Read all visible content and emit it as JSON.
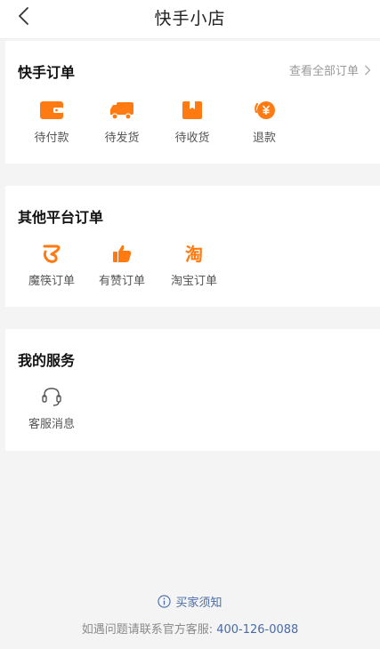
{
  "nav": {
    "title": "快手小店",
    "back_icon": "chevron-left-icon"
  },
  "kuaishou_orders": {
    "title": "快手订单",
    "see_all": "查看全部订单",
    "items": [
      {
        "label": "待付款",
        "icon": "wallet-icon"
      },
      {
        "label": "待发货",
        "icon": "truck-icon"
      },
      {
        "label": "待收货",
        "icon": "package-icon"
      },
      {
        "label": "退款",
        "icon": "refund-yen-icon"
      }
    ]
  },
  "other_platforms": {
    "title": "其他平台订单",
    "items": [
      {
        "label": "魔筷订单",
        "icon": "mokuai-logo-icon"
      },
      {
        "label": "有赞订单",
        "icon": "thumbs-up-icon"
      },
      {
        "label": "淘宝订单",
        "icon": "taobao-icon",
        "glyph": "淘"
      }
    ]
  },
  "my_services": {
    "title": "我的服务",
    "items": [
      {
        "label": "客服消息",
        "icon": "headset-icon"
      }
    ]
  },
  "footer": {
    "notice": "买家须知",
    "contact_prefix": "如遇问题请联系官方客服: ",
    "phone": "400-126-0088"
  },
  "colors": {
    "accent": "#ff7a10",
    "link": "#4a6aa6",
    "background": "#f4f4f4"
  }
}
